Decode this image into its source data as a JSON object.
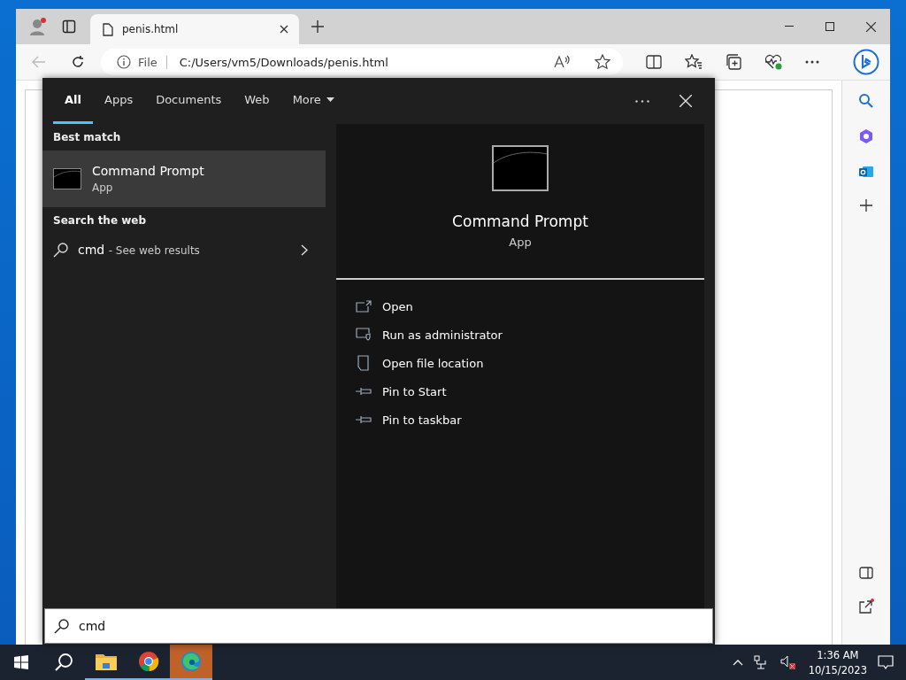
{
  "browser": {
    "tab_title": "penis.html",
    "address_label": "File",
    "url": "C:/Users/vm5/Downloads/penis.html"
  },
  "search": {
    "tabs": [
      {
        "label": "All",
        "selected": true
      },
      {
        "label": "Apps",
        "selected": false
      },
      {
        "label": "Documents",
        "selected": false
      },
      {
        "label": "Web",
        "selected": false
      },
      {
        "label": "More",
        "selected": false,
        "dropdown": true
      }
    ],
    "best_match_heading": "Best match",
    "best_match": {
      "name": "Command Prompt",
      "type": "App",
      "selected": true
    },
    "web_heading": "Search the web",
    "web_result": {
      "query": "cmd",
      "suffix": "- See web results"
    },
    "preview": {
      "name": "Command Prompt",
      "type": "App"
    },
    "actions": [
      {
        "label": "Open",
        "kind": "open"
      },
      {
        "label": "Run as administrator",
        "kind": "admin"
      },
      {
        "label": "Open file location",
        "kind": "folder"
      },
      {
        "label": "Pin to Start",
        "kind": "pin"
      },
      {
        "label": "Pin to taskbar",
        "kind": "pin"
      }
    ],
    "query": "cmd"
  },
  "taskbar": {
    "apps": [
      {
        "kind": "explorer",
        "selected": false
      },
      {
        "kind": "chrome",
        "selected": false
      },
      {
        "kind": "edge",
        "selected": true
      }
    ],
    "time": "1:36 AM",
    "date": "10/15/2023"
  }
}
